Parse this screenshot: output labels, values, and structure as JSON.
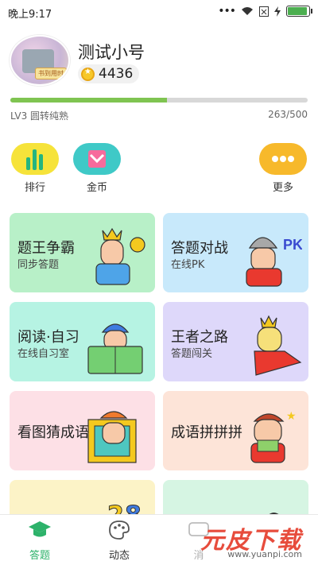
{
  "status_bar": {
    "time": "晚上9:17"
  },
  "profile": {
    "username": "测试小号",
    "coins": "4436",
    "avatar_stamp": "书到用时"
  },
  "level": {
    "label": "LV3 圆转纯熟",
    "current": 263,
    "max": 500,
    "progress_text": "263/500"
  },
  "quick_actions": [
    {
      "label": "排行",
      "icon": "ranking-bar-icon",
      "color": "#f6e33a"
    },
    {
      "label": "金币",
      "icon": "gold-coin-envelope-icon",
      "color": "#3fc9c7"
    },
    {
      "label": "更多",
      "icon": "more-dots-icon",
      "color": "#f7b92b"
    }
  ],
  "cards": [
    {
      "title": "题王争霸",
      "subtitle": "同步答题",
      "bg": "#b8f0c8"
    },
    {
      "title": "答题对战",
      "subtitle": "在线PK",
      "bg": "#c8e9fb"
    },
    {
      "title": "阅读·自习",
      "subtitle": "在线自习室",
      "bg": "#b6f3e3"
    },
    {
      "title": "王者之路",
      "subtitle": "答题闯关",
      "bg": "#ded8fa"
    },
    {
      "title": "看图猜成语",
      "subtitle": "",
      "bg": "#fde0e6"
    },
    {
      "title": "成语拼拼拼",
      "subtitle": "",
      "bg": "#fde4d8"
    },
    {
      "title": "",
      "subtitle": "",
      "bg": "#fcf3c7"
    },
    {
      "title": "",
      "subtitle": "",
      "bg": "#d6f5e3"
    }
  ],
  "tabbar": [
    {
      "label": "答题",
      "active": true
    },
    {
      "label": "动态",
      "active": false
    },
    {
      "label": "消",
      "active": false
    }
  ],
  "watermark": {
    "text": "元皮下载",
    "url": "www.yuanpi.com"
  },
  "colors": {
    "accent_green": "#2db26a",
    "progress_green": "#7fc451"
  }
}
